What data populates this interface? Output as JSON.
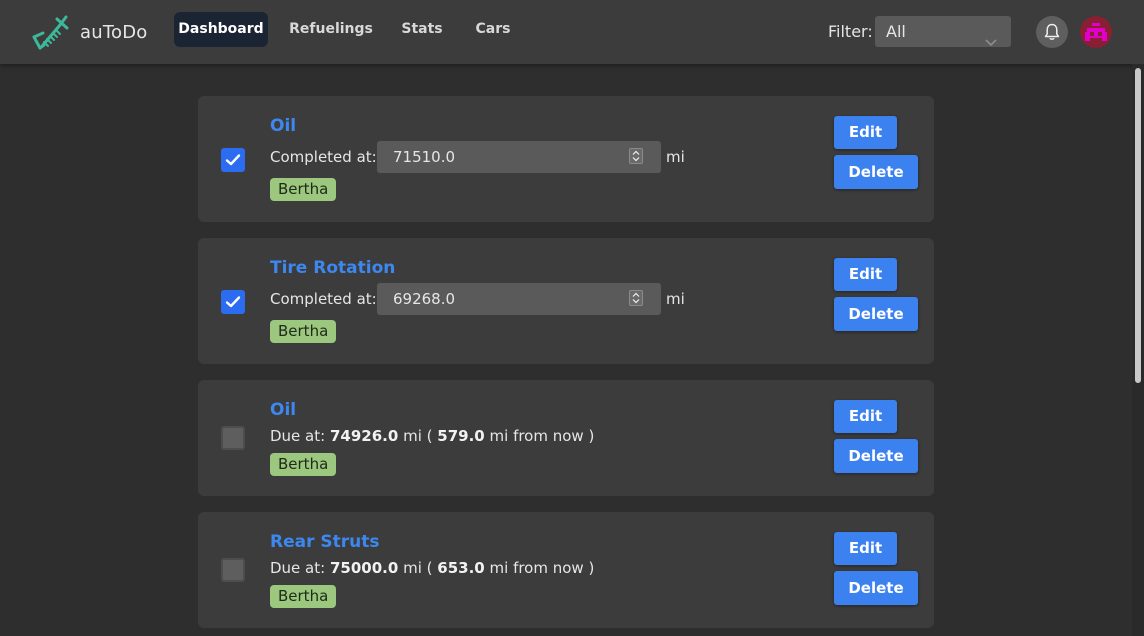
{
  "app": {
    "name": "auToDo",
    "logo_icon": "shock-absorber-icon",
    "accent": "#3db89a"
  },
  "nav": {
    "tabs": [
      {
        "label": "Dashboard",
        "active": true
      },
      {
        "label": "Refuelings",
        "active": false
      },
      {
        "label": "Stats",
        "active": false
      },
      {
        "label": "Cars",
        "active": false
      }
    ]
  },
  "filter": {
    "label": "Filter:",
    "value": "All"
  },
  "header_icons": {
    "bell": "bell-icon",
    "avatar": "avatar-icon"
  },
  "todos": [
    {
      "title": "Oil",
      "completed": true,
      "completed_label": "Completed at:",
      "completed_value": "71510.0",
      "unit": "mi",
      "car": "Bertha",
      "edit": "Edit",
      "delete": "Delete"
    },
    {
      "title": "Tire Rotation",
      "completed": true,
      "completed_label": "Completed at:",
      "completed_value": "69268.0",
      "unit": "mi",
      "car": "Bertha",
      "edit": "Edit",
      "delete": "Delete"
    },
    {
      "title": "Oil",
      "completed": false,
      "due_label": "Due at:",
      "due_value": "74926.0",
      "unit": "mi",
      "paren_open": "(",
      "remaining": "579.0",
      "remaining_suffix": "mi from now )",
      "car": "Bertha",
      "edit": "Edit",
      "delete": "Delete"
    },
    {
      "title": "Rear Struts",
      "completed": false,
      "due_label": "Due at:",
      "due_value": "75000.0",
      "unit": "mi",
      "paren_open": "(",
      "remaining": "653.0",
      "remaining_suffix": "mi from now )",
      "car": "Bertha",
      "edit": "Edit",
      "delete": "Delete"
    }
  ],
  "colors": {
    "primary": "#3b82f0",
    "tag_bg": "#9bc77e",
    "card_bg": "#3c3c3c",
    "page_bg": "#2e2e2e"
  }
}
